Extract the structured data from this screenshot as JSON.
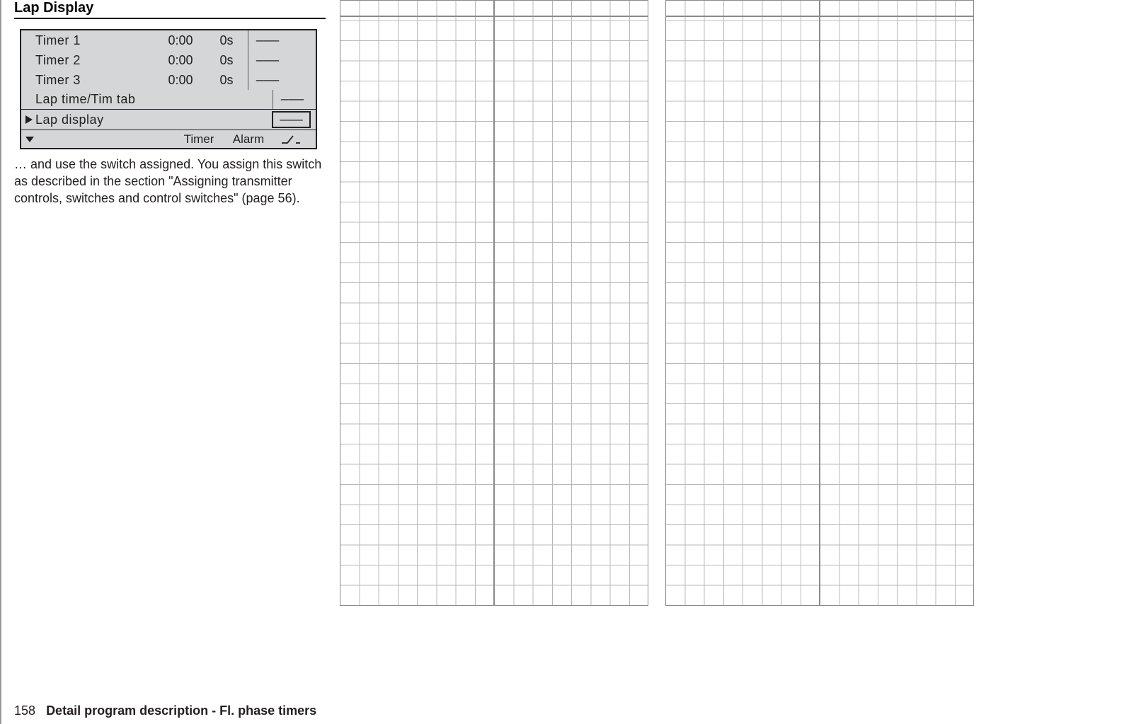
{
  "section_title": "Lap Display",
  "lcd": {
    "rows": [
      {
        "label": "Timer 1",
        "time": "0:00",
        "sec": "0s",
        "switch": "–––"
      },
      {
        "label": "Timer 2",
        "time": "0:00",
        "sec": "0s",
        "switch": "–––"
      },
      {
        "label": "Timer 3",
        "time": "0:00",
        "sec": "0s",
        "switch": "–––"
      }
    ],
    "lap_row": {
      "label": "Lap time/Tim tab",
      "switch": "–––"
    },
    "selected": {
      "label": "Lap display",
      "switch": "–––"
    },
    "footer": {
      "col1": "Timer",
      "col2": "Alarm"
    }
  },
  "paragraph": "… and use the switch assigned. You assign this switch as described in the section \"Assigning transmitter controls, switches and control switches\" (page 56).",
  "footer": {
    "page_number": "158",
    "text": "Detail program description - Fl. phase timers"
  }
}
